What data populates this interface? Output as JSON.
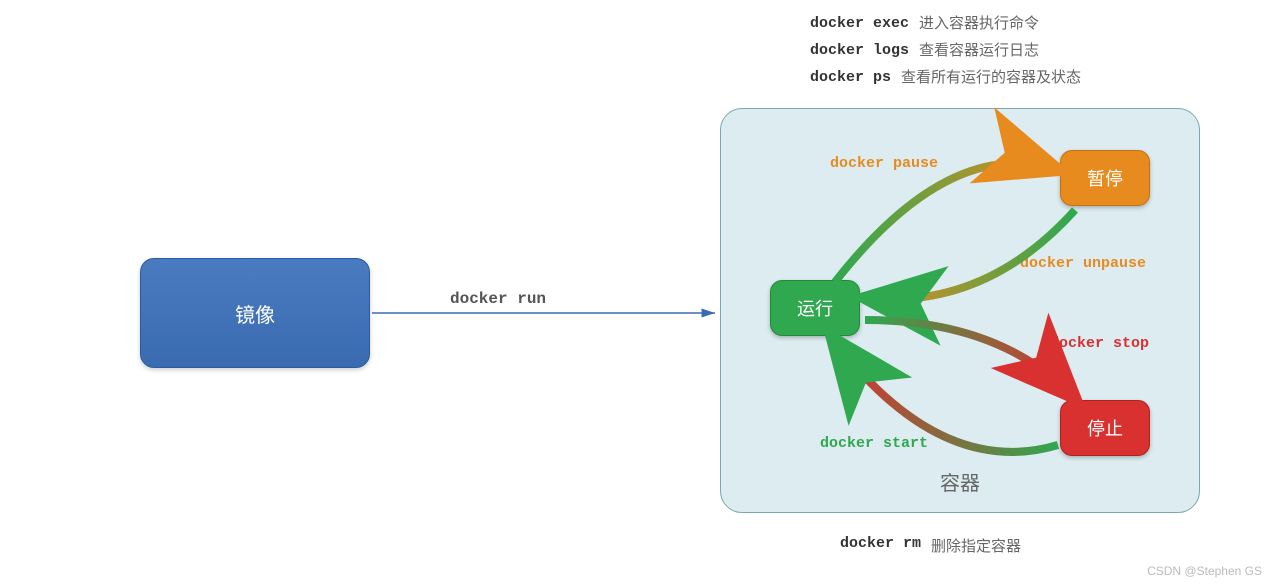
{
  "commands_top": [
    {
      "cmd": "docker exec",
      "desc": "进入容器执行命令"
    },
    {
      "cmd": "docker logs",
      "desc": "查看容器运行日志"
    },
    {
      "cmd": "docker ps",
      "desc": "查看所有运行的容器及状态"
    }
  ],
  "image_box": "镜像",
  "run_command": "docker run",
  "container_title": "容器",
  "states": {
    "run": "运行",
    "pause": "暂停",
    "stop": "停止"
  },
  "labels": {
    "pause": "docker pause",
    "unpause": "docker unpause",
    "stop": "docker stop",
    "start": "docker start"
  },
  "rm": {
    "cmd": "docker rm",
    "desc": "删除指定容器"
  },
  "watermark": "CSDN @Stephen GS"
}
